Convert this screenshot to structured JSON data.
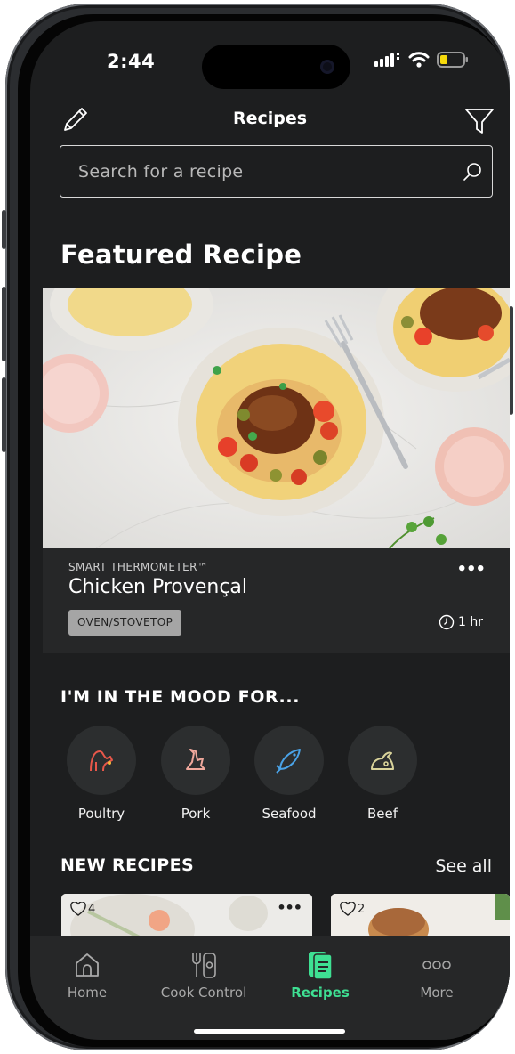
{
  "status_bar": {
    "time": "2:44"
  },
  "header": {
    "title": "Recipes"
  },
  "search": {
    "placeholder": "Search for a recipe"
  },
  "featured": {
    "heading": "Featured Recipe",
    "kicker": "SMART THERMOMETER™",
    "title": "Chicken Provençal",
    "tag": "OVEN/STOVETOP",
    "time": "1 hr",
    "more": "•••"
  },
  "mood": {
    "heading": "I'M IN THE MOOD FOR...",
    "items": [
      {
        "label": "Poultry",
        "icon": "poultry-icon"
      },
      {
        "label": "Pork",
        "icon": "pork-icon"
      },
      {
        "label": "Seafood",
        "icon": "seafood-icon"
      },
      {
        "label": "Beef",
        "icon": "beef-icon"
      }
    ]
  },
  "new_recipes": {
    "heading": "NEW RECIPES",
    "see_all": "See all",
    "cards": [
      {
        "likes": "4",
        "more": "•••"
      },
      {
        "likes": "2"
      }
    ]
  },
  "tabbar": {
    "items": [
      {
        "label": "Home",
        "icon": "home-icon"
      },
      {
        "label": "Cook Control",
        "icon": "cook-control-icon"
      },
      {
        "label": "Recipes",
        "icon": "recipes-icon"
      },
      {
        "label": "More",
        "icon": "more-icon"
      }
    ],
    "active": "Recipes"
  },
  "colors": {
    "background": "#1d1e1f",
    "accent": "#3ee093",
    "card": "#262728",
    "poultry": "#e8574a",
    "pork": "#f0a89c",
    "seafood": "#4aa3e8",
    "beef": "#d9d39a"
  }
}
